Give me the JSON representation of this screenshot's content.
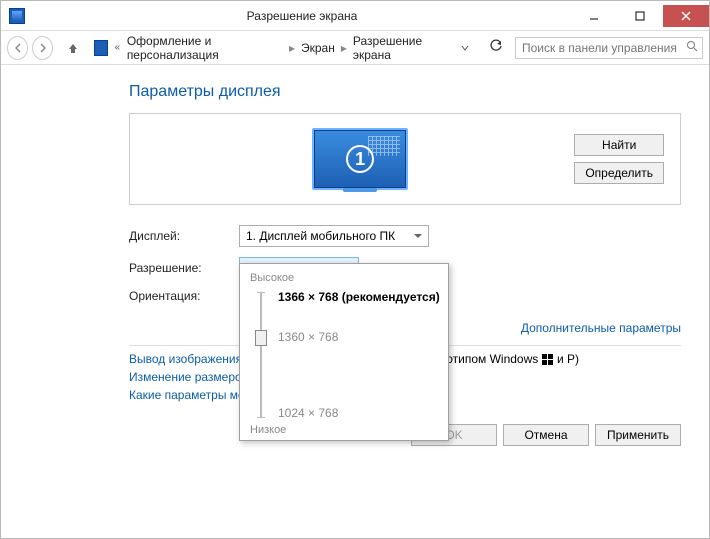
{
  "window": {
    "title": "Разрешение экрана"
  },
  "nav": {
    "crumb1": "Оформление и персонализация",
    "crumb2": "Экран",
    "crumb3": "Разрешение экрана",
    "search_placeholder": "Поиск в панели управления"
  },
  "page": {
    "heading": "Параметры дисплея",
    "find_btn": "Найти",
    "detect_btn": "Определить",
    "monitor_label": "1"
  },
  "labels": {
    "display": "Дисплей:",
    "resolution": "Разрешение:",
    "orientation": "Ориентация:"
  },
  "values": {
    "display": "1. Дисплей мобильного ПК",
    "resolution": "1360 × 768"
  },
  "popup": {
    "high": "Высокое",
    "low": "Низкое",
    "opt_recommended": "1366 × 768 (рекомендуется)",
    "opt_mid": "1360 × 768",
    "opt_low": "1024 × 768"
  },
  "links": {
    "advanced": "Дополнительные параметры",
    "proj_pre": "Вывод изображения на",
    "proj_suf": "готипом Windows",
    "proj_tail": " и P)",
    "resize": "Изменение размеров те",
    "which": "Какие параметры мони"
  },
  "footer": {
    "ok": "OK",
    "cancel": "Отмена",
    "apply": "Применить"
  }
}
